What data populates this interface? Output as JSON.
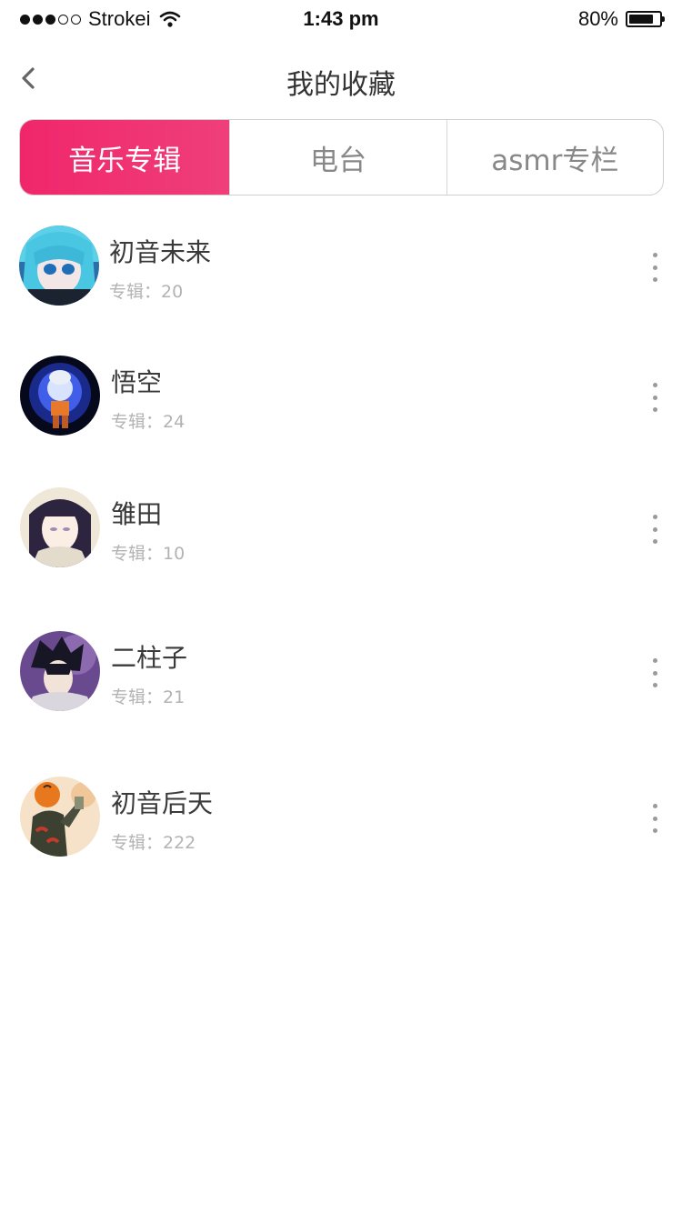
{
  "status_bar": {
    "signal_filled": 3,
    "signal_total": 5,
    "carrier": "Strokei",
    "time": "1:43 pm",
    "battery_percent_label": "80%",
    "battery_level": 0.8
  },
  "nav": {
    "title": "我的收藏",
    "back_icon": "chevron-left-icon"
  },
  "tabs": [
    {
      "label": "音乐专辑",
      "active": true
    },
    {
      "label": "电台",
      "active": false
    },
    {
      "label": "asmr专栏",
      "active": false
    }
  ],
  "colors": {
    "accent_start": "#f0266b",
    "accent_end": "#ef3f7a"
  },
  "items": [
    {
      "title": "初音未来",
      "subtitle": "专辑：20"
    },
    {
      "title": "悟空",
      "subtitle": "专辑：24"
    },
    {
      "title": "雏田",
      "subtitle": "专辑：10"
    },
    {
      "title": "二柱子",
      "subtitle": "专辑：21"
    },
    {
      "title": "初音后天",
      "subtitle": "专辑：222"
    }
  ]
}
